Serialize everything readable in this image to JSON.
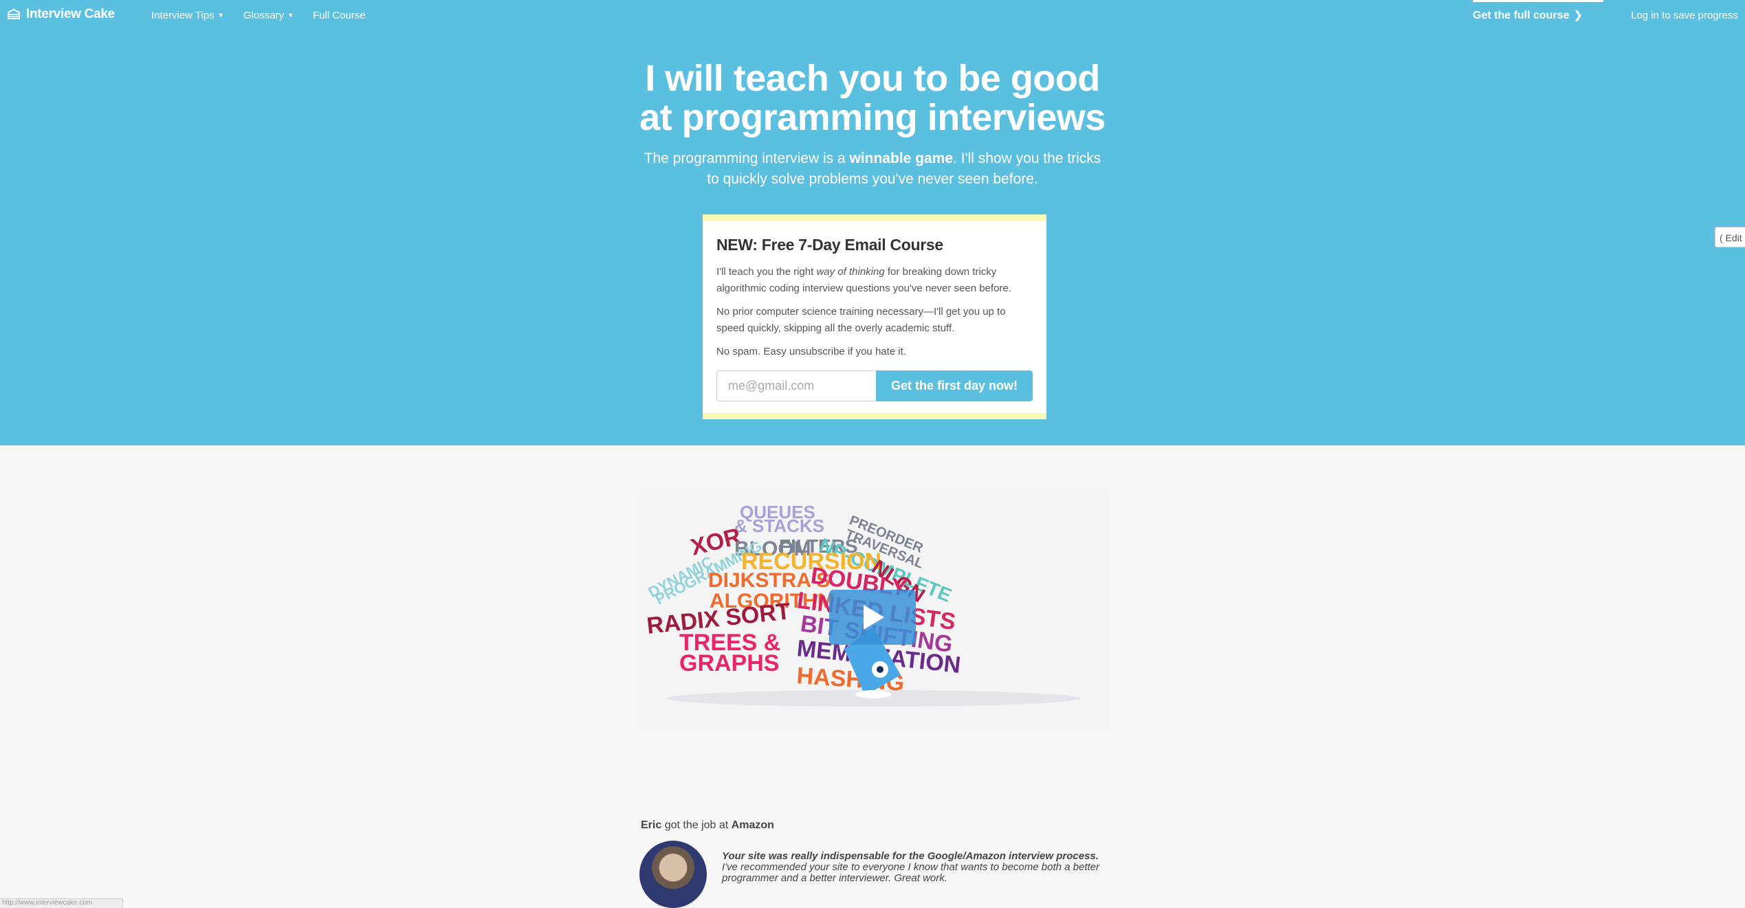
{
  "nav": {
    "brand": "Interview Cake",
    "items": [
      {
        "label": "Interview Tips",
        "has_caret": true
      },
      {
        "label": "Glossary",
        "has_caret": true
      },
      {
        "label": "Full Course",
        "has_caret": false
      }
    ],
    "cta": "Get the full course",
    "login": "Log in to save progress"
  },
  "hero": {
    "title_line1": "I will teach you to be good",
    "title_line2": "at programming interviews",
    "sub_pre": "The programming interview is a ",
    "sub_bold": "winnable game",
    "sub_post": ". I'll show you the tricks",
    "sub_line2": "to quickly solve problems you've never seen before."
  },
  "signup": {
    "heading": "NEW: Free 7-Day Email Course",
    "p1_pre": "I'll teach you the right ",
    "p1_em": "way of thinking",
    "p1_post": " for breaking down tricky algorithmic coding interview questions you've never seen before.",
    "p2": "No prior computer science training necessary—I'll get you up to speed quickly, skipping all the overly academic stuff.",
    "p3": "No spam. Easy unsubscribe if you hate it.",
    "email_placeholder": "me@gmail.com",
    "button": "Get the first day now!"
  },
  "edit_tab": "( Edit",
  "video": {
    "words": [
      {
        "text": "QUEUES",
        "color": "#a9a0d8"
      },
      {
        "text": "& STACKS",
        "color": "#a9a0d8"
      },
      {
        "text": "PREORDER",
        "color": "#7a8294"
      },
      {
        "text": "TRAVERSAL",
        "color": "#7a8294"
      },
      {
        "text": "XOR",
        "color": "#b31f46"
      },
      {
        "text": "BLOOM",
        "color": "#7a8294"
      },
      {
        "text": "FILTERS",
        "color": "#7a8294"
      },
      {
        "text": "NP-COMPLETE",
        "color": "#5cc6c0"
      },
      {
        "text": "DYNAMIC",
        "color": "#8fd3d8"
      },
      {
        "text": "PROGRAMMING",
        "color": "#8fd3d8"
      },
      {
        "text": "RECURSION",
        "color": "#f5b32b"
      },
      {
        "text": "NLGN",
        "color": "#b31f46"
      },
      {
        "text": "DIJKSTRA'S",
        "color": "#f06a2d"
      },
      {
        "text": "ALGORITHM",
        "color": "#f06a2d"
      },
      {
        "text": "DOUBLY",
        "color": "#d62564"
      },
      {
        "text": "LINKED LISTS",
        "color": "#d62564"
      },
      {
        "text": "RADIX SORT",
        "color": "#9e1b3d"
      },
      {
        "text": "BIT SHIFTING",
        "color": "#a23a9a"
      },
      {
        "text": "TREES &",
        "color": "#e8246a"
      },
      {
        "text": "GRAPHS",
        "color": "#e8246a"
      },
      {
        "text": "MEMOIZATION",
        "color": "#6a2a8a"
      },
      {
        "text": "HASHING",
        "color": "#f06a2d"
      }
    ]
  },
  "testimonial": {
    "name": "Eric",
    "got_job": " got the job at ",
    "company": "Amazon",
    "quote_bold": "Your site was really indispensable for the Google/Amazon interview process.",
    "quote_rest": " I've recommended your site to everyone I know that wants to become both a better programmer and a better interviewer. Great work."
  },
  "status_url": "http://www.interviewcake.com"
}
